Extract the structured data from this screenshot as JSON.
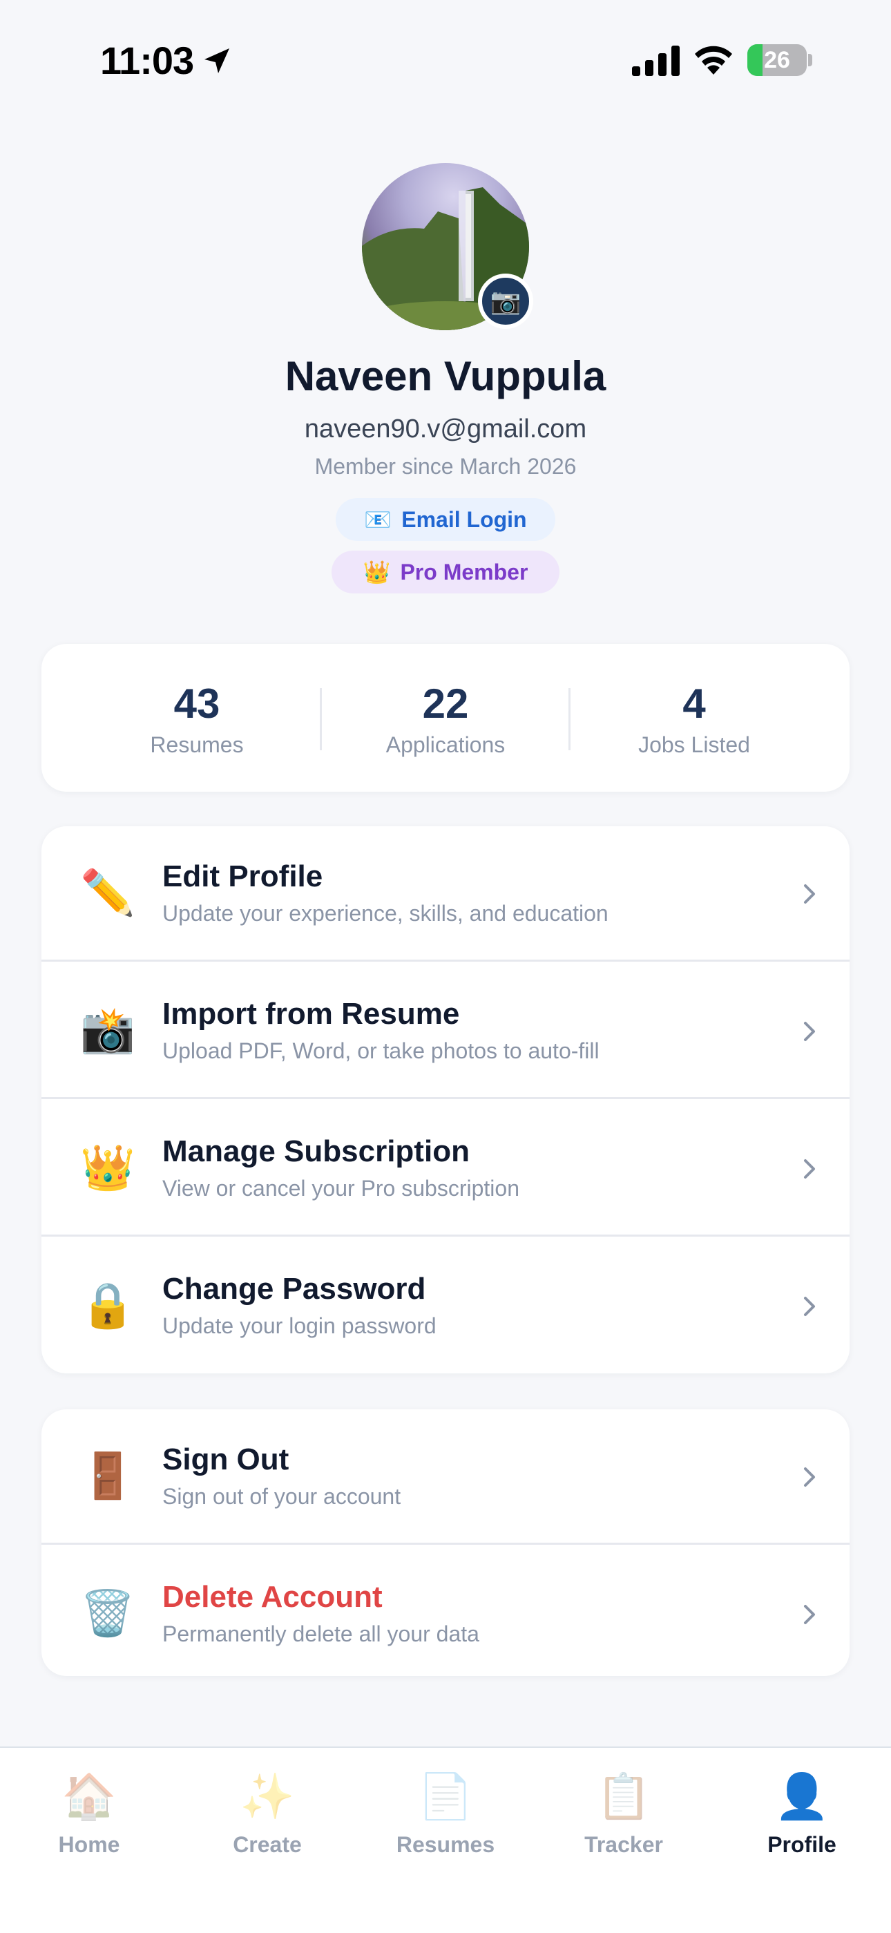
{
  "status_bar": {
    "time": "11:03",
    "battery": "26",
    "battery_percent": 26
  },
  "profile": {
    "name": "Naveen Vuppula",
    "email": "naveen90.v@gmail.com",
    "member_since": "Member since March 2026",
    "login_badge": {
      "icon": "📧",
      "label": "Email Login"
    },
    "plan_badge": {
      "icon": "👑",
      "label": "Pro Member"
    },
    "camera_icon": "📷"
  },
  "stats": [
    {
      "value": "43",
      "label": "Resumes"
    },
    {
      "value": "22",
      "label": "Applications"
    },
    {
      "value": "4",
      "label": "Jobs Listed"
    }
  ],
  "menu": [
    {
      "icon": "✏️",
      "title": "Edit Profile",
      "subtitle": "Update your experience, skills, and education"
    },
    {
      "icon": "📸",
      "title": "Import from Resume",
      "subtitle": "Upload PDF, Word, or take photos to auto-fill"
    },
    {
      "icon": "👑",
      "title": "Manage Subscription",
      "subtitle": "View or cancel your Pro subscription"
    },
    {
      "icon": "🔒",
      "title": "Change Password",
      "subtitle": "Update your login password"
    }
  ],
  "account": [
    {
      "icon": "🚪",
      "title": "Sign Out",
      "subtitle": "Sign out of your account"
    },
    {
      "icon": "🗑️",
      "title": "Delete Account",
      "subtitle": "Permanently delete all your data"
    }
  ],
  "tabs": [
    {
      "icon": "🏠",
      "label": "Home"
    },
    {
      "icon": "✨",
      "label": "Create"
    },
    {
      "icon": "📄",
      "label": "Resumes"
    },
    {
      "icon": "📋",
      "label": "Tracker"
    },
    {
      "icon": "👤",
      "label": "Profile"
    }
  ],
  "colors": {
    "accent_navy": "#1e3358",
    "danger": "#e04545",
    "email_pill": "#2166d1",
    "pro_pill": "#7b3bc9",
    "battery_green": "#34c759"
  }
}
